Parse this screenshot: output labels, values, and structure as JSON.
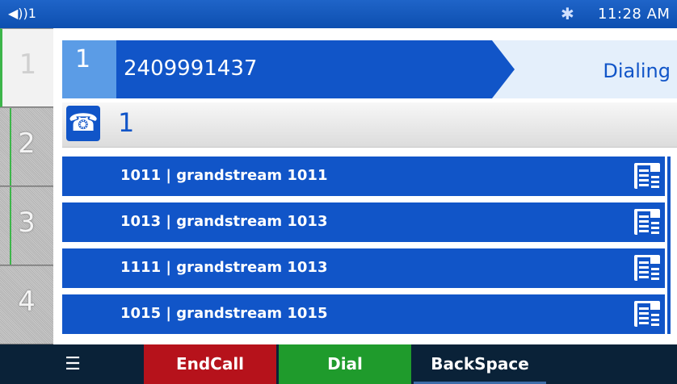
{
  "status_bar": {
    "volume": "◀))1",
    "bluetooth_icon": "bluetooth-icon",
    "time": "11:28 AM"
  },
  "line_keys": [
    {
      "label": "1",
      "active": true
    },
    {
      "label": "2",
      "active": false
    },
    {
      "label": "3",
      "active": false
    },
    {
      "label": "4",
      "active": false
    }
  ],
  "call": {
    "index": "1",
    "number": "2409991437",
    "state": "Dialing"
  },
  "input": {
    "phone_icon": "phone-icon",
    "value": "1"
  },
  "contacts": [
    {
      "label": "1011 | grandstream 1011",
      "icon": "company-icon"
    },
    {
      "label": "1013 | grandstream 1013",
      "icon": "company-icon"
    },
    {
      "label": "1111 | grandstream 1013",
      "icon": "company-icon"
    },
    {
      "label": "1015 | grandstream 1015",
      "icon": "company-icon"
    }
  ],
  "softkeys": {
    "menu_icon": "menu-icon",
    "endcall": "EndCall",
    "dial": "Dial",
    "backspace": "BackSpace"
  },
  "colors": {
    "primary": "#1155c8",
    "endcall": "#b6121b",
    "dial": "#1f9b2c",
    "softkey_bar": "#0a2238"
  }
}
